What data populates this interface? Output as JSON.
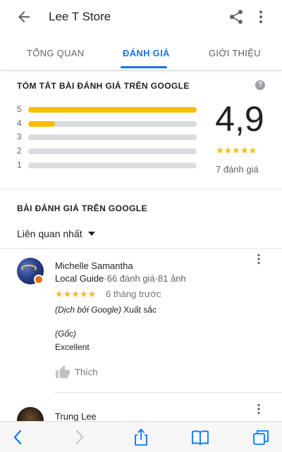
{
  "app_bar": {
    "title": "Lee T Store",
    "back_icon": "arrow-back-icon",
    "share_icon": "share-icon",
    "more_icon": "more-vert-icon"
  },
  "tabs": [
    {
      "label": "TỔNG QUAN",
      "active": false
    },
    {
      "label": "ĐÁNH GIÁ",
      "active": true
    },
    {
      "label": "GIỚI THIỆU",
      "active": false
    }
  ],
  "summary": {
    "title": "TÓM TẮT BÀI ĐÁNH GIÁ TRÊN GOOGLE",
    "help_glyph": "?",
    "rating": "4,9",
    "stars": "★★★★★",
    "count_label": "7 đánh giá",
    "distribution": [
      {
        "star": "5",
        "fraction": 1.0
      },
      {
        "star": "4",
        "fraction": 0.16
      },
      {
        "star": "3",
        "fraction": 0.0
      },
      {
        "star": "2",
        "fraction": 0.0
      },
      {
        "star": "1",
        "fraction": 0.0
      }
    ]
  },
  "reviews_section": {
    "title": "BÀI ĐÁNH GIÁ TRÊN GOOGLE",
    "sort_label": "Liên quan nhất"
  },
  "reviews": [
    {
      "name": "Michelle Samantha",
      "badge": "Local Guide",
      "stats": "·66 đánh giá·81 ảnh",
      "stars": "★★★★★",
      "date": "6 tháng trước",
      "translated_prefix": "(Dịch bởi Google)",
      "translated_text": " Xuất sắc",
      "original_label": "(Gốc)",
      "original_text": "Excellent",
      "like_label": "Thích"
    },
    {
      "name": "Trung Lee"
    }
  ],
  "bottom_bar": {
    "icons": [
      "back-icon",
      "forward-icon",
      "share-icon",
      "bookmarks-icon",
      "tabs-icon"
    ]
  },
  "colors": {
    "accent": "#1a73e8",
    "star": "#fbbc04",
    "bar_track": "#dadce0",
    "safari_blue": "#007aff"
  }
}
